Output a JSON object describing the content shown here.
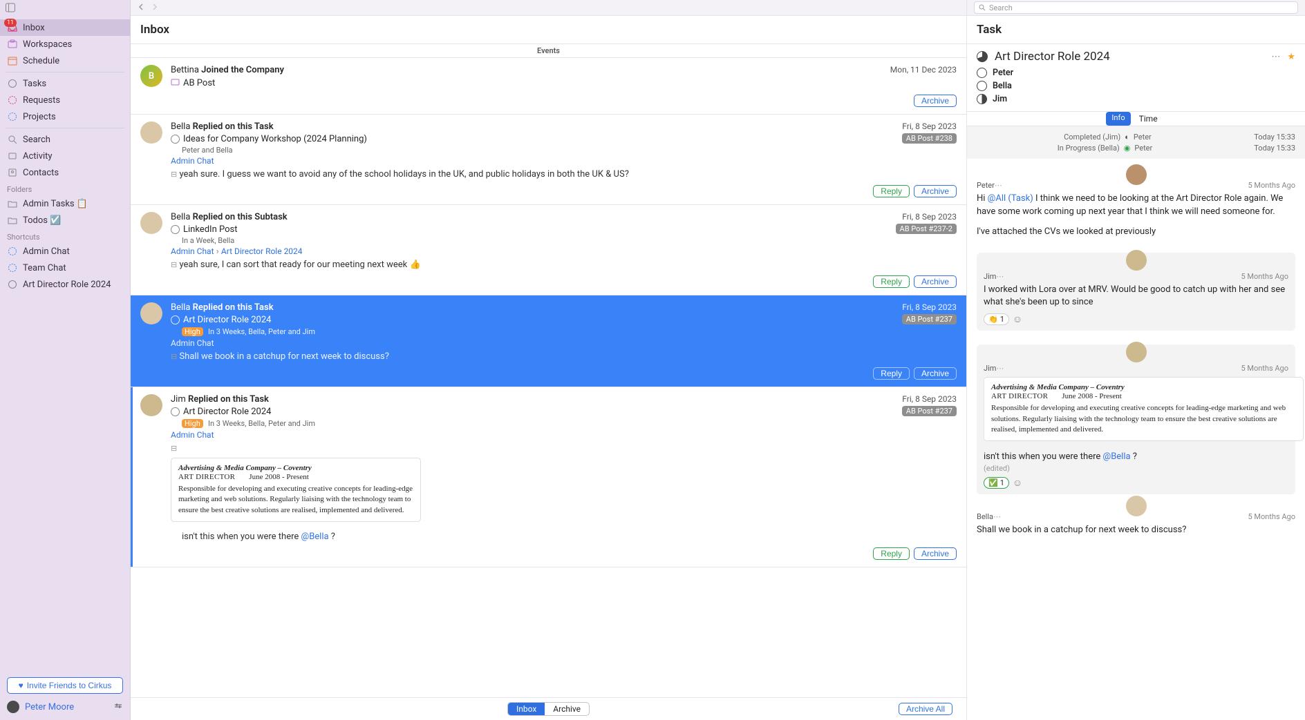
{
  "sidebar": {
    "inbox_count": "11",
    "items": {
      "inbox": "Inbox",
      "workspaces": "Workspaces",
      "schedule": "Schedule",
      "tasks": "Tasks",
      "requests": "Requests",
      "projects": "Projects",
      "search": "Search",
      "activity": "Activity",
      "contacts": "Contacts"
    },
    "folders_heading": "Folders",
    "folders": {
      "admin_tasks": "Admin Tasks 📋",
      "todos": "Todos ☑️"
    },
    "shortcuts_heading": "Shortcuts",
    "shortcuts": {
      "admin_chat": "Admin Chat",
      "team_chat": "Team Chat",
      "art_director": "Art Director Role 2024"
    },
    "invite_btn": "Invite Friends to Cirkus",
    "user_name": "Peter Moore"
  },
  "center": {
    "title": "Inbox",
    "events_header": "Events",
    "events": [
      {
        "who": "Bettina",
        "action": "Joined the Company",
        "date": "Mon, 11 Dec 2023",
        "sub": "AB Post"
      },
      {
        "who": "Bella",
        "action": "Replied on this Task",
        "date": "Fri, 8 Sep 2023",
        "ref": "AB Post #238",
        "task": "Ideas for Company Workshop (2024 Planning)",
        "meta": "Peter and Bella",
        "crumb": "Admin Chat",
        "msg": "yeah sure.  I guess we want to avoid any of the school holidays in the UK, and public holidays in both the UK & US?"
      },
      {
        "who": "Bella",
        "action": "Replied on this Subtask",
        "date": "Fri, 8 Sep 2023",
        "ref": "AB Post #237-2",
        "task": "LinkedIn Post",
        "meta": "In a Week, Bella",
        "crumb1": "Admin Chat",
        "crumb2": "Art Director Role 2024",
        "msg": "yeah sure, I can sort that ready for our meeting next week 👍"
      },
      {
        "who": "Bella",
        "action": "Replied on this Task",
        "date": "Fri, 8 Sep 2023",
        "ref": "AB Post #237",
        "task": "Art Director Role 2024",
        "priority": "High",
        "meta": "In 3 Weeks, Bella, Peter and Jim",
        "crumb": "Admin Chat",
        "msg": "Shall we book in a catchup for next week to discuss?"
      },
      {
        "who": "Jim",
        "action": "Replied on this Task",
        "date": "Fri, 8 Sep 2023",
        "ref": "AB Post #237",
        "task": "Art Director Role 2024",
        "priority": "High",
        "meta": "In 3 Weeks, Bella, Peter and Jim",
        "crumb": "Admin Chat",
        "cv_company": "Advertising & Media Company – Coventry",
        "cv_role": "ART DIRECTOR",
        "cv_dates": "June 2008 - Present",
        "cv_desc": "Responsible for developing and executing creative concepts for leading-edge marketing and web solutions. Regularly liaising with the technology team to ensure the best creative solutions are realised, implemented and delivered.",
        "msg_after": "isn't this when you were there ",
        "msg_mention": "@Bella",
        "msg_tail": " ?"
      }
    ],
    "reply_label": "Reply",
    "archive_label": "Archive",
    "archive_all": "Archive All",
    "seg_inbox": "Inbox",
    "seg_archive": "Archive"
  },
  "right": {
    "search_placeholder": "Search",
    "title": "Task",
    "task_title": "Art Director Role 2024",
    "assignees": [
      {
        "name": "Peter",
        "state": "empty"
      },
      {
        "name": "Bella",
        "state": "empty"
      },
      {
        "name": "Jim",
        "state": "half"
      }
    ],
    "tab_info": "Info",
    "tab_time": "Time",
    "status": [
      {
        "label": "Completed (Jim)",
        "mark": "complete",
        "who": "Peter",
        "time": "Today 15:33"
      },
      {
        "label": "In Progress (Bella)",
        "mark": "progress",
        "who": "Peter",
        "time": "Today 15:33"
      }
    ],
    "thread": [
      {
        "name": "Peter",
        "ago": "5 Months Ago",
        "body_pre": "Hi ",
        "mention": "@All (Task)",
        "body_post": " I think we need to be looking at the Art Director Role again.  We have some work coming up next year that I think we will need someone for.",
        "body2": "I've attached the CVs we looked at previously",
        "boxed": false
      },
      {
        "name": "Jim",
        "ago": "5 Months Ago",
        "body": "I worked with Lora over at MRV.  Would be good to catch up with her and see what she's been up to since",
        "react_emoji": "👏",
        "react_count": "1",
        "boxed": true
      },
      {
        "name": "Jim",
        "ago": "5 Months Ago",
        "cv_company": "Advertising & Media Company – Coventry",
        "cv_role": "ART DIRECTOR",
        "cv_dates": "June 2008 - Present",
        "cv_desc": "Responsible for developing and executing creative concepts for leading-edge marketing and web solutions. Regularly liaising with the technology team to ensure the best creative solutions are realised, implemented and delivered.",
        "body_after": "isn't this when you were there ",
        "mention": "@Bella",
        "body_tail": " ?",
        "edited": "(edited)",
        "react_emoji": "✅",
        "react_count": "1",
        "boxed": true
      },
      {
        "name": "Bella",
        "ago": "5 Months Ago",
        "body": "Shall we book in a catchup for next week to discuss?",
        "boxed": false
      }
    ]
  }
}
